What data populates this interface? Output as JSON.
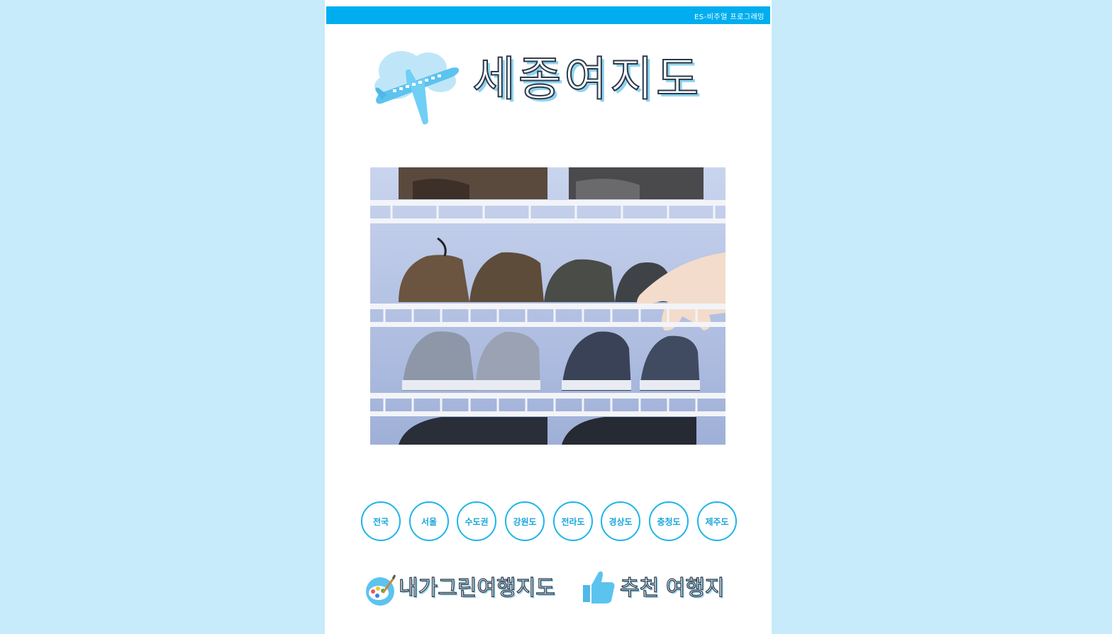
{
  "header": {
    "site_label": "ES-비주얼 프로그래밍"
  },
  "logo": {
    "title": "세종여지도",
    "icon": "airplane-cloud-icon"
  },
  "hero": {
    "description": "photo of shoes on a wire shoe rack with a hand"
  },
  "regions": [
    {
      "label": "전국"
    },
    {
      "label": "서울"
    },
    {
      "label": "수도권"
    },
    {
      "label": "강원도"
    },
    {
      "label": "전라도"
    },
    {
      "label": "경상도"
    },
    {
      "label": "충청도"
    },
    {
      "label": "제주도"
    }
  ],
  "links": {
    "my_map": {
      "label": "내가그린여행지도",
      "icon": "palette-icon"
    },
    "recommended": {
      "label": "추천 여행지",
      "icon": "thumbs-up-icon"
    }
  },
  "colors": {
    "background": "#c7ebfa",
    "accent": "#00aeef",
    "circle_border": "#1fb4ea",
    "circle_text": "#1aa6db"
  }
}
